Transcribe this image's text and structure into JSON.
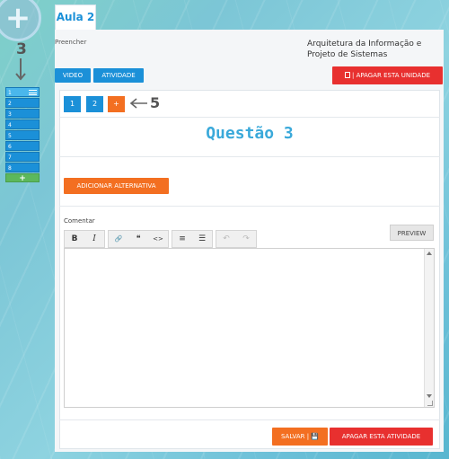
{
  "sidebar": {
    "add_symbol": "+",
    "step_number": "3",
    "units": [
      {
        "label": "1",
        "active": true
      },
      {
        "label": "2",
        "active": false
      },
      {
        "label": "3",
        "active": false
      },
      {
        "label": "4",
        "active": false
      },
      {
        "label": "5",
        "active": false
      },
      {
        "label": "6",
        "active": false
      },
      {
        "label": "7",
        "active": false
      },
      {
        "label": "8",
        "active": false
      }
    ],
    "add_unit_symbol": "+"
  },
  "header": {
    "tab_label": "Aula 2",
    "subtitle": "Preencher",
    "course_title": "Arquitetura da Informação e Projeto de Sistemas",
    "video_label": "VIDEO",
    "atividade_label": "ATIVIDADE",
    "apagar_unidade_label": "| APAGAR ESTA UNIDADE"
  },
  "questions": {
    "tabs": [
      "1",
      "2"
    ],
    "add_label": "+",
    "step_number": "5"
  },
  "question": {
    "title": "Questão 3",
    "add_alternative_label": "ADICIONAR ALTERNATIVA",
    "comment_label": "Comentar",
    "preview_label": "PREVIEW",
    "editor_value": ""
  },
  "toolbar": {
    "bold": "B",
    "italic": "I",
    "link": "🔗",
    "quote": "❝",
    "code": "<>",
    "ordered_list": "≡",
    "bullet_list": "☰",
    "undo": "↶",
    "redo": "↷"
  },
  "footer": {
    "salvar_label": "SALVAR | 💾",
    "apagar_atividade_label": "APAGAR ESTA ATIVIDADE"
  },
  "colors": {
    "primary": "#1b90d8",
    "accent": "#f36f21",
    "danger": "#e8302f",
    "success": "#5cb85c",
    "title": "#3aa9da"
  }
}
